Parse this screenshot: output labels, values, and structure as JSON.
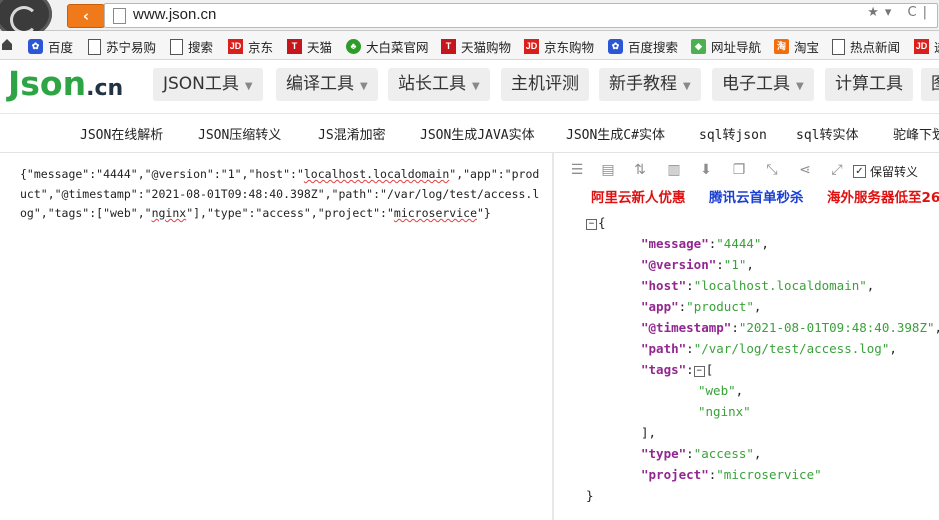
{
  "browser": {
    "url": "www.json.cn",
    "back_label": "‹"
  },
  "bookmarks": [
    {
      "label": "百度",
      "icon": "paw-icon"
    },
    {
      "label": "苏宁易购",
      "icon": "page-icon"
    },
    {
      "label": "搜索",
      "icon": "page-icon"
    },
    {
      "label": "京东",
      "icon": "jd-icon"
    },
    {
      "label": "天猫",
      "icon": "tmall-icon"
    },
    {
      "label": "大白菜官网",
      "icon": "cabbage-icon"
    },
    {
      "label": "天猫购物",
      "icon": "tmall-icon"
    },
    {
      "label": "京东购物",
      "icon": "jd-icon"
    },
    {
      "label": "百度搜索",
      "icon": "paw-icon"
    },
    {
      "label": "网址导航",
      "icon": "nav-icon"
    },
    {
      "label": "淘宝",
      "icon": "taobao-icon"
    },
    {
      "label": "热点新闻",
      "icon": "page-icon"
    },
    {
      "label": "递",
      "icon": "jd-icon"
    }
  ],
  "site": {
    "logo_main": "Json",
    "logo_suffix": ".cn",
    "menu": [
      {
        "label": "JSON工具",
        "dropdown": true
      },
      {
        "label": "编译工具",
        "dropdown": true
      },
      {
        "label": "站长工具",
        "dropdown": true
      },
      {
        "label": "主机评测",
        "dropdown": false
      },
      {
        "label": "新手教程",
        "dropdown": true
      },
      {
        "label": "电子工具",
        "dropdown": true
      },
      {
        "label": "计算工具",
        "dropdown": false
      },
      {
        "label": "图",
        "dropdown": false
      }
    ],
    "tools": [
      "JSON在线解析",
      "JSON压缩转义",
      "JS混淆加密",
      "JSON生成JAVA实体",
      "JSON生成C#实体",
      "sql转json",
      "sql转实体",
      "驼峰下划"
    ]
  },
  "input": {
    "parts": [
      "{\"message\":\"4444\",\"@version\":\"1\",\"host\":\"",
      "localhost.localdomain",
      "\",\"app\":\"product\",\"@timestamp\":\"2021-08-01T09:48:40.398Z\",\"path\":\"/var/log/test/access.log\",\"tags\":[\"web\",\"",
      "nginx",
      "\"],\"type\":\"access\",\"project\":\"",
      "microservice",
      "\"}"
    ]
  },
  "output": {
    "keep_escape_label": "保留转义",
    "keep_escape_checked": "✓",
    "promos": [
      {
        "label": "阿里云新人优惠",
        "color": "#e01010"
      },
      {
        "label": "腾讯云首单秒杀",
        "color": "#1a3fd1"
      },
      {
        "label": "海外服务器低至26",
        "color": "#e01010"
      }
    ],
    "toggle_minus": "⊟",
    "open_brace": "{",
    "close_brace": "}",
    "entries": [
      {
        "key": "\"message\"",
        "value": "\"4444\""
      },
      {
        "key": "\"@version\"",
        "value": "\"1\""
      },
      {
        "key": "\"host\"",
        "value": "\"localhost.localdomain\""
      },
      {
        "key": "\"app\"",
        "value": "\"product\""
      },
      {
        "key": "\"@timestamp\"",
        "value": "\"2021-08-01T09:48:40.398Z\""
      },
      {
        "key": "\"path\"",
        "value": "\"/var/log/test/access.log\""
      }
    ],
    "tags_key": "\"tags\"",
    "tags_values": [
      "\"web\"",
      "\"nginx\""
    ],
    "tail_entries": [
      {
        "key": "\"type\"",
        "value": "\"access\""
      },
      {
        "key": "\"project\"",
        "value": "\"microservice\""
      }
    ]
  },
  "colors": {
    "logo_green": "#2ea544",
    "key_purple": "#92278f",
    "value_green": "#3aa13a",
    "back_orange": "#f07a1a"
  }
}
